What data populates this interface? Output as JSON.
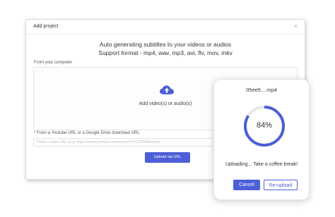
{
  "modal": {
    "title": "Add project",
    "close": "×",
    "headline_1": "Auto generating subtitles to your videos or audios",
    "headline_2": "Support format - mp4, wav, mp3, avi, flv, mov, mkv",
    "computer_label": "From your computer",
    "dropzone_text": "Add video(s) or audio(s)",
    "url_label": "* From a Youtube URL or a Google Drive download URL",
    "url_placeholder": "Paste a video URL (e.g. https://www.youtube.com/watch?v=CCOPh6kebnk)",
    "url_button": "Upload via URL"
  },
  "upload_card": {
    "file_name": "05ee5....mp4",
    "progress_label": "84%",
    "progress_fraction": 0.84,
    "status": "Uploading... Take a coffee break!",
    "cancel_button": "Cancel",
    "reupload_button": "Re-upload"
  },
  "colors": {
    "accent": "#4c5fd7",
    "ring_track": "#e8e8e8"
  },
  "icons": {
    "upload": "cloud-upload-icon",
    "close": "close-icon"
  }
}
